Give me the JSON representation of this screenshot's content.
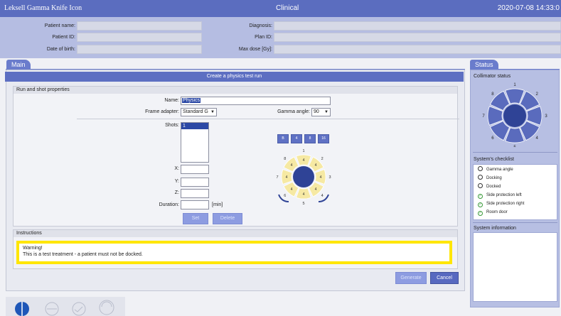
{
  "titlebar": {
    "app": "Leksell Gamma Knife Icon",
    "mode": "Clinical",
    "clock": "2020-07-08 14:33:0"
  },
  "patient": {
    "name_label": "Patient name:",
    "id_label": "Patient ID:",
    "dob_label": "Date of birth:",
    "diagnosis_label": "Diagnosis:",
    "plan_label": "Plan ID:",
    "maxdose_label": "Max dose [Gy]:"
  },
  "tabs": {
    "main": "Main",
    "status": "Status"
  },
  "dialog": {
    "title": "Create a physics test run",
    "group_title": "Run and shot properties",
    "name_label": "Name:",
    "name_value": "Physics",
    "adapter_label": "Frame adapter:",
    "adapter_value": "Standard G",
    "gamma_label": "Gamma angle:",
    "gamma_value": "90",
    "shots_label": "Shots:",
    "shots": [
      "1"
    ],
    "x_label": "X:",
    "y_label": "Y:",
    "z_label": "Z:",
    "duration_label": "Duration:",
    "duration_unit": "[min]",
    "set_button": "Set",
    "delete_button": "Delete",
    "sizes": [
      "B",
      "4",
      "8",
      "16"
    ],
    "sector_numbers": [
      "1",
      "2",
      "3",
      "4",
      "5",
      "6",
      "7",
      "8"
    ],
    "sector_values": [
      "4",
      "4",
      "4",
      "4",
      "4",
      "4",
      "4",
      "4"
    ]
  },
  "instructions": {
    "title": "Instructions",
    "line1": "Warning!",
    "line2": "This is a test treatment - a patient must not be docked."
  },
  "actions": {
    "generate": "Generate",
    "cancel": "Cancel"
  },
  "status": {
    "collimator_title": "Collimator status",
    "sector_numbers": [
      "1",
      "2",
      "3",
      "4",
      "5",
      "6",
      "7",
      "8"
    ],
    "checklist_title": "System's checklist",
    "checklist": [
      {
        "label": "Gamma angle",
        "done": false
      },
      {
        "label": "Docking",
        "done": false
      },
      {
        "label": "Docked",
        "done": false
      },
      {
        "label": "Side protection left",
        "done": true
      },
      {
        "label": "Side protection right",
        "done": true
      },
      {
        "label": "Room door",
        "done": true
      }
    ],
    "sysinfo_title": "System information"
  },
  "colors": {
    "accent": "#5b6dbf",
    "warning": "#ffe600",
    "sector_on": "#5a6bbd",
    "sector_yellow": "#f6e9a3"
  }
}
